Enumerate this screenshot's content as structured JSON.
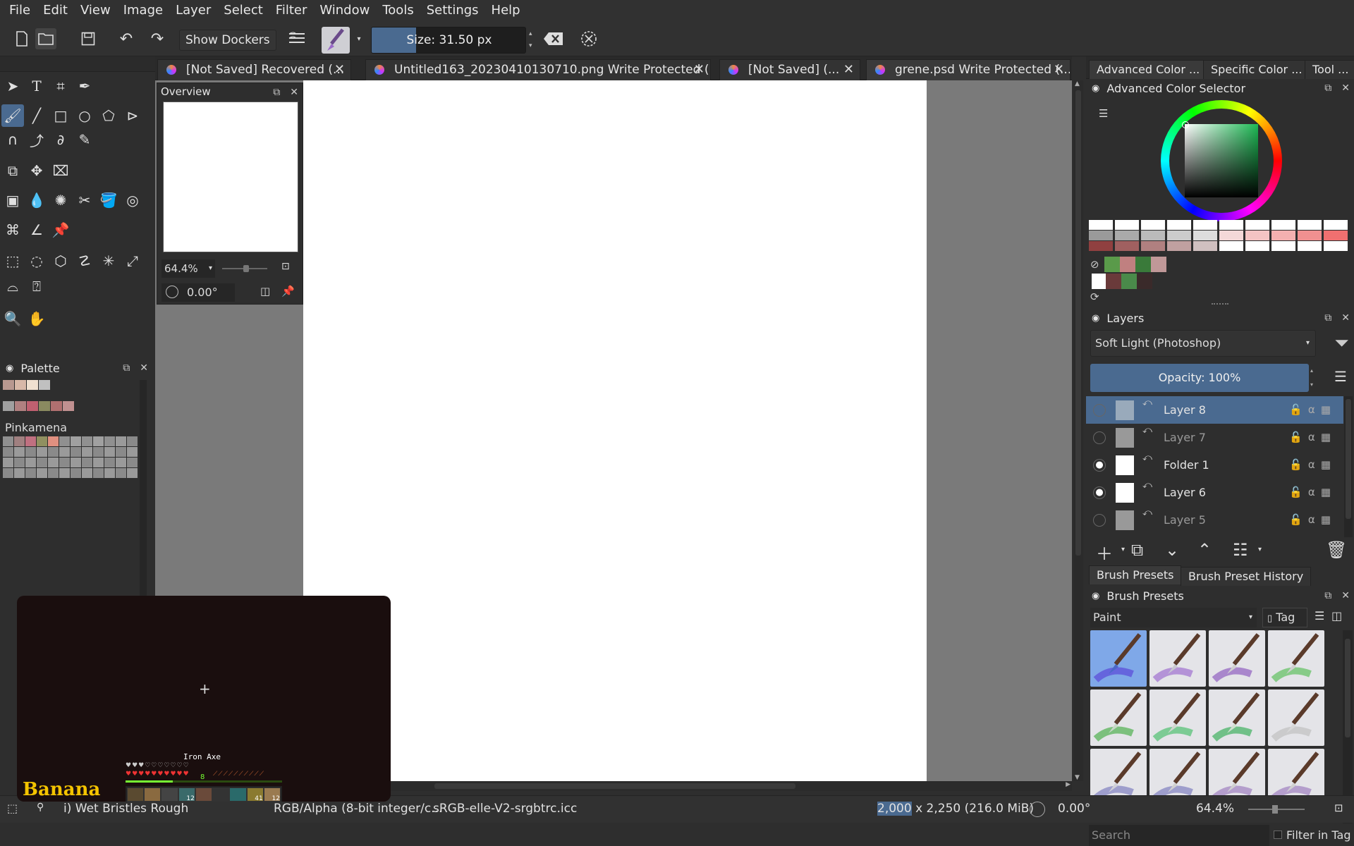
{
  "menu": [
    "File",
    "Edit",
    "View",
    "Image",
    "Layer",
    "Select",
    "Filter",
    "Window",
    "Tools",
    "Settings",
    "Help"
  ],
  "toolbar": {
    "show_dockers": "Show Dockers",
    "size_label": "Size: 31.50 px",
    "size_fraction": 0.29
  },
  "tabs": [
    {
      "label": "[Not Saved]  Recovered  (..."
    },
    {
      "label": "Untitled163_20230410130710.png Write Protected  (..."
    },
    {
      "label": "[Not Saved]  (..."
    },
    {
      "label": "grene.psd Write Protected  (..."
    }
  ],
  "overview": {
    "title": "Overview",
    "zoom": "64.4%",
    "rotation": "0.00°"
  },
  "palette": {
    "title": "Palette",
    "group_name": "Pinkamena"
  },
  "right_tabs": [
    "Advanced Color ...",
    "Specific Color ...",
    "Tool ..."
  ],
  "color_selector": {
    "title": "Advanced Color Selector"
  },
  "layers": {
    "title": "Layers",
    "blend_mode": "Soft Light (Photoshop)",
    "opacity": "Opacity:  100%",
    "items": [
      {
        "name": "Layer 8",
        "visible": false,
        "selected": true
      },
      {
        "name": "Layer 7",
        "visible": false,
        "selected": false
      },
      {
        "name": "Folder 1",
        "visible": true,
        "selected": false
      },
      {
        "name": "Layer 6",
        "visible": true,
        "selected": false
      },
      {
        "name": "Layer 5",
        "visible": false,
        "selected": false
      }
    ]
  },
  "brush_tabs": [
    "Brush Presets",
    "Brush Preset History"
  ],
  "brush_presets": {
    "title": "Brush Presets",
    "category": "Paint",
    "tag": "Tag",
    "search_placeholder": "Search",
    "filter_in_tag": "Filter in Tag"
  },
  "statusbar": {
    "brush": "i) Wet Bristles Rough",
    "colorspace": "RGB/Alpha (8-bit integer/c...",
    "profile": "sRGB-elle-V2-srgbtrc.icc",
    "dimensions_pre": "2,000",
    "dimensions_post": " x 2,250 (216.0 MiB)",
    "rotation": "0.00°",
    "zoom": "64.4%"
  },
  "video_overlay": {
    "item_label": "Iron Axe",
    "brand": "Banana",
    "level": "8",
    "slot_counts": [
      "12",
      "41",
      "12"
    ]
  },
  "colors": {
    "accent": "#4a6a90",
    "panel": "#2e2e2e",
    "canvas_bg": "#7a7a7a"
  }
}
